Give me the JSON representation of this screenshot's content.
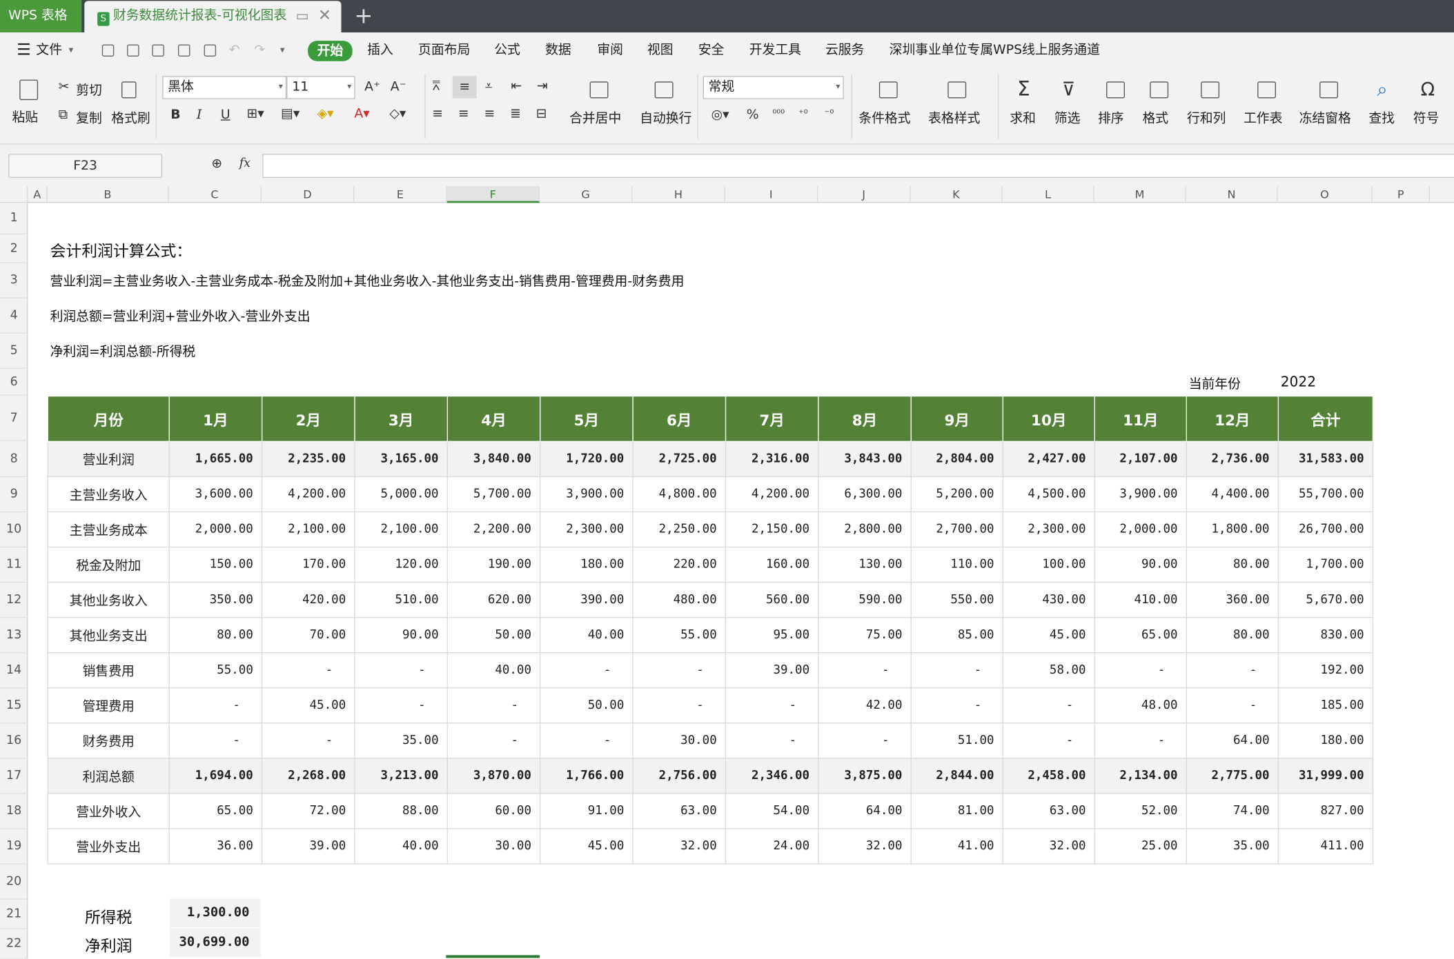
{
  "app": {
    "name": "WPS 表格",
    "doc_tab": "财务数据统计报表-可视化图表",
    "doc_icon": "S",
    "new_tab": "+"
  },
  "menu": {
    "file": "文件",
    "items": [
      "开始",
      "插入",
      "页面布局",
      "公式",
      "数据",
      "审阅",
      "视图",
      "安全",
      "开发工具",
      "云服务",
      "深圳事业单位专属WPS线上服务通道"
    ]
  },
  "ribbon": {
    "paste": "粘贴",
    "cut": "剪切",
    "copy": "复制",
    "format_painter": "格式刷",
    "font": "黑体",
    "size": "11",
    "merge": "合并居中",
    "wrap": "自动换行",
    "numfmt": "常规",
    "cond_format": "条件格式",
    "table_style": "表格样式",
    "sum": "求和",
    "filter": "筛选",
    "sort": "排序",
    "format": "格式",
    "rowcol": "行和列",
    "worksheet": "工作表",
    "freeze": "冻结窗格",
    "find": "查找",
    "symbol": "符号",
    "bold": "B",
    "italic": "I",
    "underline": "U",
    "percent": "%"
  },
  "formula_bar": {
    "cell": "F23",
    "fx": "fx",
    "value": ""
  },
  "columns": [
    "A",
    "B",
    "C",
    "D",
    "E",
    "F",
    "G",
    "H",
    "I",
    "J",
    "K",
    "L",
    "M",
    "N",
    "O",
    "P"
  ],
  "rows": [
    "1",
    "2",
    "3",
    "4",
    "5",
    "6",
    "7",
    "8",
    "9",
    "10",
    "11",
    "12",
    "13",
    "14",
    "15",
    "16",
    "17",
    "18",
    "19",
    "20",
    "21",
    "22"
  ],
  "sheet": {
    "heading": "会计利润计算公式：",
    "f1": "营业利润=主营业务收入-主营业务成本-税金及附加+其他业务收入-其他业务支出-销售费用-管理费用-财务费用",
    "f2": "利润总额=营业利润+营业外收入-营业外支出",
    "f3": "净利润=利润总额-所得税",
    "year_label": "当前年份",
    "year": "2022",
    "header": [
      "月份",
      "1月",
      "2月",
      "3月",
      "4月",
      "5月",
      "6月",
      "7月",
      "8月",
      "9月",
      "10月",
      "11月",
      "12月",
      "合计"
    ],
    "rows": [
      [
        "营业利润",
        "1,665.00",
        "2,235.00",
        "3,165.00",
        "3,840.00",
        "1,720.00",
        "2,725.00",
        "2,316.00",
        "3,843.00",
        "2,804.00",
        "2,427.00",
        "2,107.00",
        "2,736.00",
        "31,583.00"
      ],
      [
        "主营业务收入",
        "3,600.00",
        "4,200.00",
        "5,000.00",
        "5,700.00",
        "3,900.00",
        "4,800.00",
        "4,200.00",
        "6,300.00",
        "5,200.00",
        "4,500.00",
        "3,900.00",
        "4,400.00",
        "55,700.00"
      ],
      [
        "主营业务成本",
        "2,000.00",
        "2,100.00",
        "2,100.00",
        "2,200.00",
        "2,300.00",
        "2,250.00",
        "2,150.00",
        "2,800.00",
        "2,700.00",
        "2,300.00",
        "2,000.00",
        "1,800.00",
        "26,700.00"
      ],
      [
        "税金及附加",
        "150.00",
        "170.00",
        "120.00",
        "190.00",
        "180.00",
        "220.00",
        "160.00",
        "130.00",
        "110.00",
        "100.00",
        "90.00",
        "80.00",
        "1,700.00"
      ],
      [
        "其他业务收入",
        "350.00",
        "420.00",
        "510.00",
        "620.00",
        "390.00",
        "480.00",
        "560.00",
        "590.00",
        "550.00",
        "430.00",
        "410.00",
        "360.00",
        "5,670.00"
      ],
      [
        "其他业务支出",
        "80.00",
        "70.00",
        "90.00",
        "50.00",
        "40.00",
        "55.00",
        "95.00",
        "75.00",
        "85.00",
        "45.00",
        "65.00",
        "80.00",
        "830.00"
      ],
      [
        "销售费用",
        "55.00",
        "-",
        "-",
        "40.00",
        "-",
        "-",
        "39.00",
        "-",
        "-",
        "58.00",
        "-",
        "-",
        "192.00"
      ],
      [
        "管理费用",
        "-",
        "45.00",
        "-",
        "-",
        "50.00",
        "-",
        "-",
        "42.00",
        "-",
        "-",
        "48.00",
        "-",
        "185.00"
      ],
      [
        "财务费用",
        "-",
        "-",
        "35.00",
        "-",
        "-",
        "30.00",
        "-",
        "-",
        "51.00",
        "-",
        "-",
        "64.00",
        "180.00"
      ],
      [
        "利润总额",
        "1,694.00",
        "2,268.00",
        "3,213.00",
        "3,870.00",
        "1,766.00",
        "2,756.00",
        "2,346.00",
        "3,875.00",
        "2,844.00",
        "2,458.00",
        "2,134.00",
        "2,775.00",
        "31,999.00"
      ],
      [
        "营业外收入",
        "65.00",
        "72.00",
        "88.00",
        "60.00",
        "91.00",
        "63.00",
        "54.00",
        "64.00",
        "81.00",
        "63.00",
        "52.00",
        "74.00",
        "827.00"
      ],
      [
        "营业外支出",
        "36.00",
        "39.00",
        "40.00",
        "30.00",
        "45.00",
        "32.00",
        "24.00",
        "32.00",
        "41.00",
        "32.00",
        "25.00",
        "35.00",
        "411.00"
      ]
    ],
    "tax_label": "所得税",
    "tax": "1,300.00",
    "net_label": "净利润",
    "net": "30,699.00"
  }
}
